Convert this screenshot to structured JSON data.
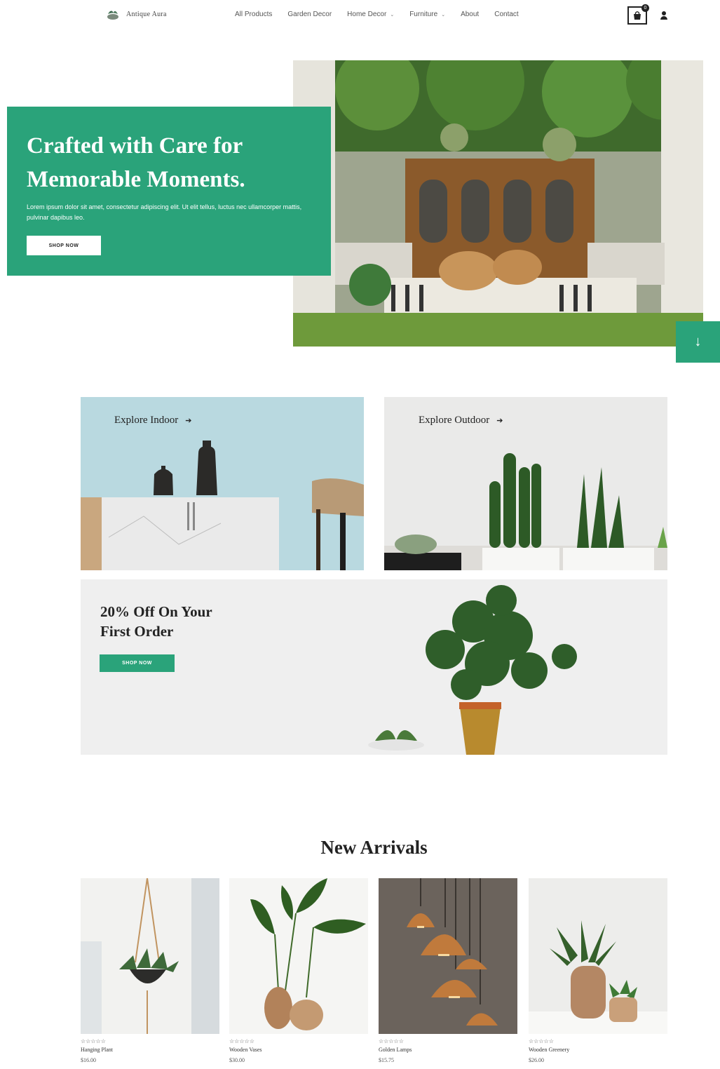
{
  "brand": {
    "name": "Antique Aura",
    "logo_icon": "leaf-bowl-icon"
  },
  "nav": {
    "items": [
      {
        "label": "All Products",
        "has_dropdown": false
      },
      {
        "label": "Garden Decor",
        "has_dropdown": false
      },
      {
        "label": "Home Decor",
        "has_dropdown": true
      },
      {
        "label": "Furniture",
        "has_dropdown": true
      },
      {
        "label": "About",
        "has_dropdown": false
      },
      {
        "label": "Contact",
        "has_dropdown": false
      }
    ],
    "cart_icon": "shopping-bag-icon",
    "cart_count": "0",
    "user_icon": "user-icon",
    "chevron": "⌄"
  },
  "hero": {
    "title_line1": "Crafted with Care for",
    "title_line2": "Memorable Moments.",
    "description": "Lorem ipsum dolor sit amet, consectetur adipiscing elit. Ut elit tellus, luctus nec ullamcorper mattis, pulvinar dapibus leo.",
    "button_label": "SHOP NOW",
    "scroll_icon": "↓",
    "accent_color": "#2aa37a"
  },
  "explore": {
    "indoor_label": "Explore Indoor",
    "outdoor_label": "Explore Outdoor",
    "arrow": "➔"
  },
  "promo": {
    "title_line1": "20% Off On Your",
    "title_line2": "First Order",
    "button_label": "SHOP NOW"
  },
  "arrivals": {
    "title": "New Arrivals",
    "products": [
      {
        "name": "Hanging Plant",
        "price": "$16.00",
        "rating": "☆☆☆☆☆"
      },
      {
        "name": "Wooden Vases",
        "price": "$30.00",
        "rating": "☆☆☆☆☆"
      },
      {
        "name": "Golden Lamps",
        "price": "$15.75",
        "rating": "☆☆☆☆☆"
      },
      {
        "name": "Wooden Greenery",
        "price": "$26.00",
        "rating": "☆☆☆☆☆"
      }
    ]
  }
}
